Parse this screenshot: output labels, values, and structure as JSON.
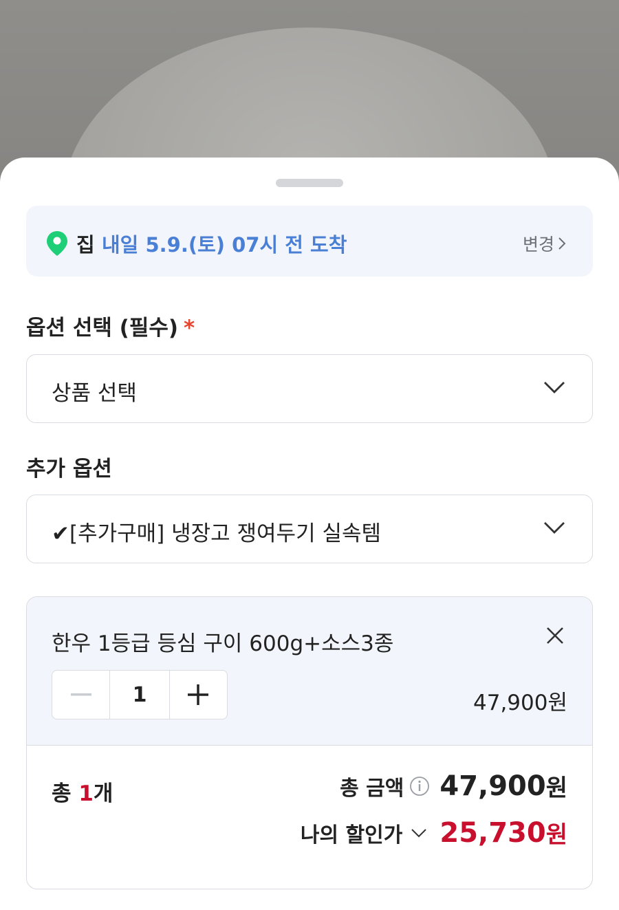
{
  "delivery": {
    "place": "집",
    "eta": "내일 5.9.(토) 07시 전 도착",
    "change_label": "변경"
  },
  "option": {
    "label": "옵션 선택 (필수)",
    "required_mark": "*",
    "selected": "상품 선택"
  },
  "addon": {
    "label": "추가 옵션",
    "selected": "✔[추가구매] 냉장고 쟁여두기 실속템"
  },
  "item": {
    "name": "한우 1등급 등심 구이 600g+소스3종",
    "quantity": "1",
    "price": "47,900원"
  },
  "summary": {
    "count_prefix": "총",
    "count_value": "1",
    "count_suffix": "개",
    "total_label": "총 금액",
    "total_amount": "47,900",
    "total_unit": "원",
    "discount_label": "나의 할인가",
    "discount_amount": "25,730",
    "discount_unit": "원"
  },
  "colors": {
    "accent_blue": "#4a7fd6",
    "discount_red": "#c8102e",
    "location_pin": "#1fcf78"
  }
}
